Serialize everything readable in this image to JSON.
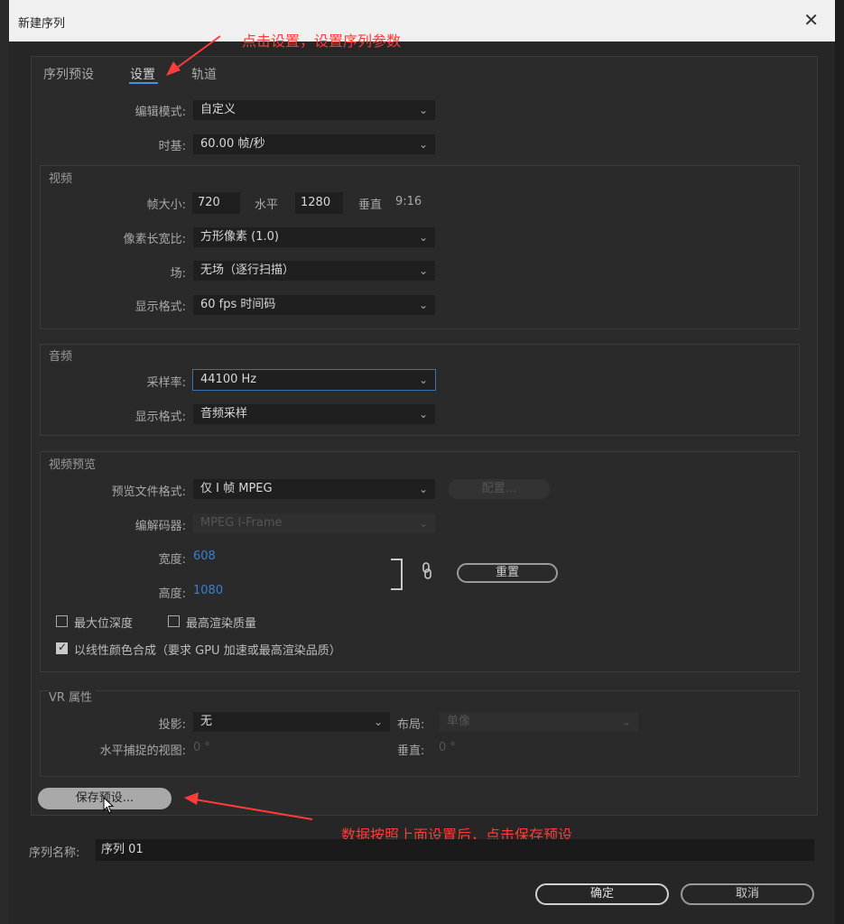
{
  "window": {
    "title": "新建序列",
    "close": "✕"
  },
  "tabs": [
    {
      "label": "序列预设"
    },
    {
      "label": "设置"
    },
    {
      "label": "轨道"
    }
  ],
  "annotations": {
    "top": "点击设置，设置序列参数",
    "bottom": "数据按照上面设置后，点击保存预设"
  },
  "general": {
    "edit_mode_label": "编辑模式:",
    "edit_mode_value": "自定义",
    "timebase_label": "时基:",
    "timebase_value": "60.00  帧/秒"
  },
  "video": {
    "title": "视频",
    "frame_size_label": "帧大小:",
    "width_value": "720",
    "horizontal_label": "水平",
    "height_value": "1280",
    "vertical_label": "垂直",
    "aspect": "9:16",
    "pixel_aspect_label": "像素长宽比:",
    "pixel_aspect_value": "方形像素 (1.0)",
    "field_label": "场:",
    "field_value": "无场（逐行扫描）",
    "display_format_label": "显示格式:",
    "display_format_value": "60 fps 时间码"
  },
  "audio": {
    "title": "音频",
    "sample_rate_label": "采样率:",
    "sample_rate_value": "44100 Hz",
    "display_format_label": "显示格式:",
    "display_format_value": "音频采样"
  },
  "preview": {
    "title": "视频预览",
    "file_format_label": "预览文件格式:",
    "file_format_value": "仅 I 帧 MPEG",
    "config_button": "配置...",
    "codec_label": "编解码器:",
    "codec_value": "MPEG I-Frame",
    "width_label": "宽度:",
    "width_value": "608",
    "height_label": "高度:",
    "height_value": "1080",
    "reset_button": "重置",
    "max_bit_depth": "最大位深度",
    "max_render_quality": "最高渲染质量",
    "linear_color": "以线性颜色合成（要求 GPU 加速或最高渲染品质）"
  },
  "vr": {
    "title": "VR 属性",
    "projection_label": "投影:",
    "projection_value": "无",
    "layout_label": "布局:",
    "layout_value": "单像",
    "h_view_label": "水平捕捉的视图:",
    "h_view_value": "0 °",
    "v_label": "垂直:",
    "v_value": "0 °"
  },
  "save_preset_button": "保存预设...",
  "sequence_name_label": "序列名称:",
  "sequence_name_value": "序列 01",
  "ok_button": "确定",
  "cancel_button": "取消"
}
